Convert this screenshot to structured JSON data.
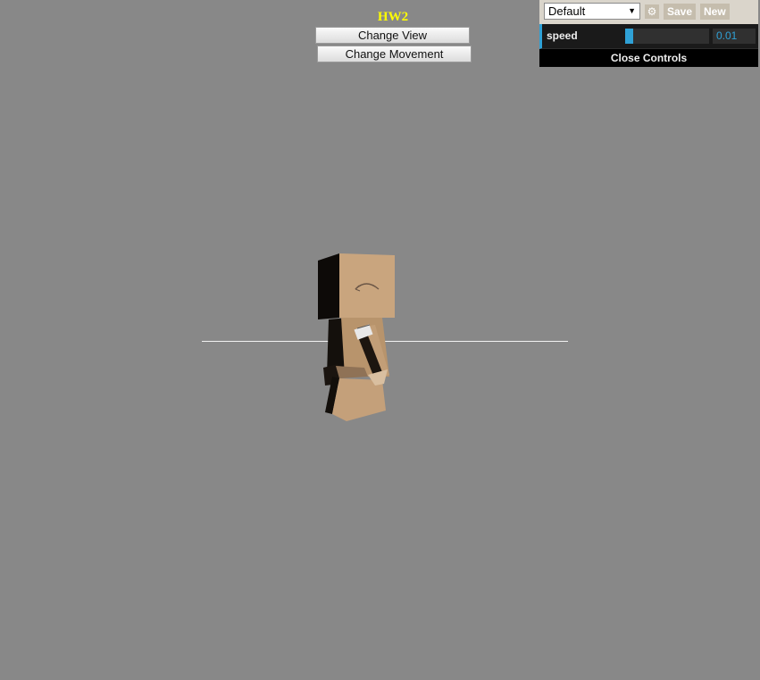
{
  "scene": {
    "title": "HW2",
    "title_color": "#ffff00",
    "background_color": "#888888",
    "buttons": {
      "change_view": "Change View",
      "change_movement": "Change Movement"
    }
  },
  "gui": {
    "preset": "Default",
    "save_label": "Save",
    "new_label": "New",
    "gear_icon": "gear-icon",
    "controls": [
      {
        "label": "speed",
        "value": "0.01",
        "slider_fraction": 0.1
      }
    ],
    "close_label": "Close Controls",
    "accent_color": "#2fa1d6"
  }
}
